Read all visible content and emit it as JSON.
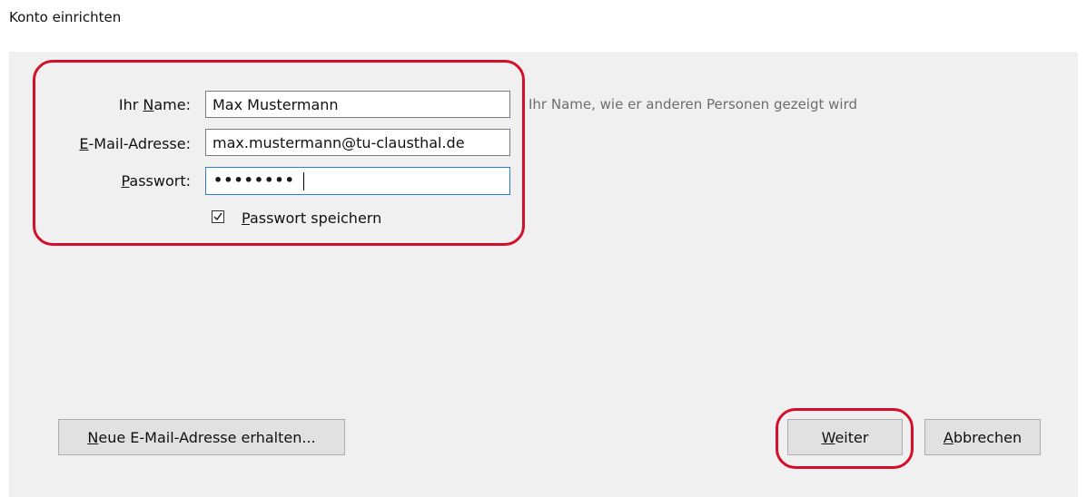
{
  "window": {
    "title": "Konto einrichten"
  },
  "form": {
    "name": {
      "label_pre": "Ihr ",
      "label_ul": "N",
      "label_post": "ame:",
      "value": "Max Mustermann",
      "hint": "Ihr Name, wie er anderen Personen gezeigt wird"
    },
    "email": {
      "label_pre": "",
      "label_ul": "E",
      "label_post": "-Mail-Adresse:",
      "value": "max.mustermann@tu-clausthal.de"
    },
    "password": {
      "label_pre": "",
      "label_ul": "P",
      "label_post": "asswort:",
      "masked": "••••••••"
    },
    "remember": {
      "checked": true,
      "label_ul": "P",
      "label_rest": "asswort speichern"
    }
  },
  "buttons": {
    "new_address": {
      "ul": "N",
      "rest": "eue E-Mail-Adresse erhalten..."
    },
    "next": {
      "ul": "W",
      "rest": "eiter"
    },
    "cancel": {
      "ul": "A",
      "rest": "bbrechen"
    }
  },
  "colors": {
    "highlight": "#d40f2a",
    "panel": "#f0f0f0",
    "focus": "#2a7fd4"
  }
}
